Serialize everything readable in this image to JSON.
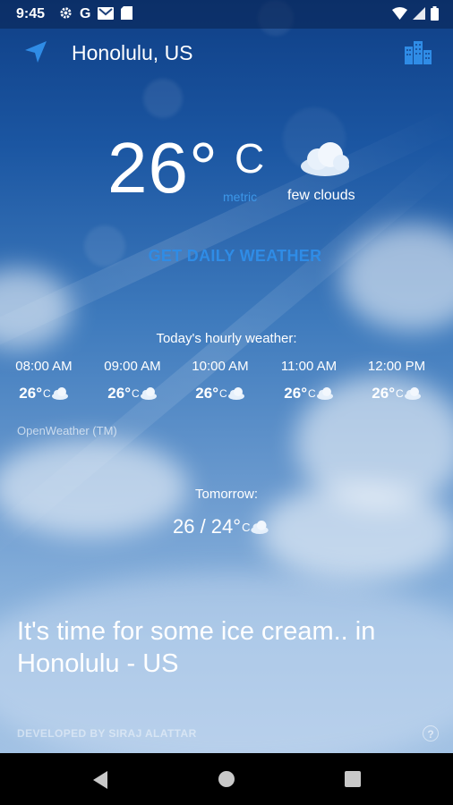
{
  "status_bar": {
    "time": "9:45",
    "left_icons": [
      "gear-icon",
      "google-icon",
      "gmail-icon",
      "sd-card-icon"
    ],
    "right_icons": [
      "wifi-icon",
      "signal-icon",
      "battery-icon"
    ]
  },
  "header": {
    "location_icon": "navigation-arrow-icon",
    "city": "Honolulu, US",
    "city_list_icon": "city-buildings-icon",
    "accent_color": "#2f8ce6"
  },
  "current": {
    "temperature": "26°",
    "unit": "C",
    "system": "metric",
    "condition": "few clouds",
    "condition_icon": "cloud-icon"
  },
  "daily_button": {
    "label": "GET DAILY WEATHER"
  },
  "hourly": {
    "title": "Today's hourly weather:",
    "items": [
      {
        "time": "08:00 AM",
        "temp": "26°",
        "unit": "C",
        "icon": "cloud-icon"
      },
      {
        "time": "09:00 AM",
        "temp": "26°",
        "unit": "C",
        "icon": "cloud-icon"
      },
      {
        "time": "10:00 AM",
        "temp": "26°",
        "unit": "C",
        "icon": "cloud-icon"
      },
      {
        "time": "11:00 AM",
        "temp": "26°",
        "unit": "C",
        "icon": "cloud-icon"
      },
      {
        "time": "12:00 PM",
        "temp": "26°",
        "unit": "C",
        "icon": "cloud-icon"
      }
    ]
  },
  "provider": "OpenWeather (TM)",
  "tomorrow": {
    "title": "Tomorrow:",
    "temps": "26 / 24°",
    "unit": "C",
    "icon": "cloud-icon"
  },
  "quote": "It's time for some ice cream.. in Honolulu - US",
  "footer": {
    "developer": "DEVELOPED BY SIRAJ ALATTAR",
    "help": "?"
  },
  "nav_bar": {
    "buttons": [
      "back-icon",
      "home-icon",
      "recents-icon"
    ]
  }
}
